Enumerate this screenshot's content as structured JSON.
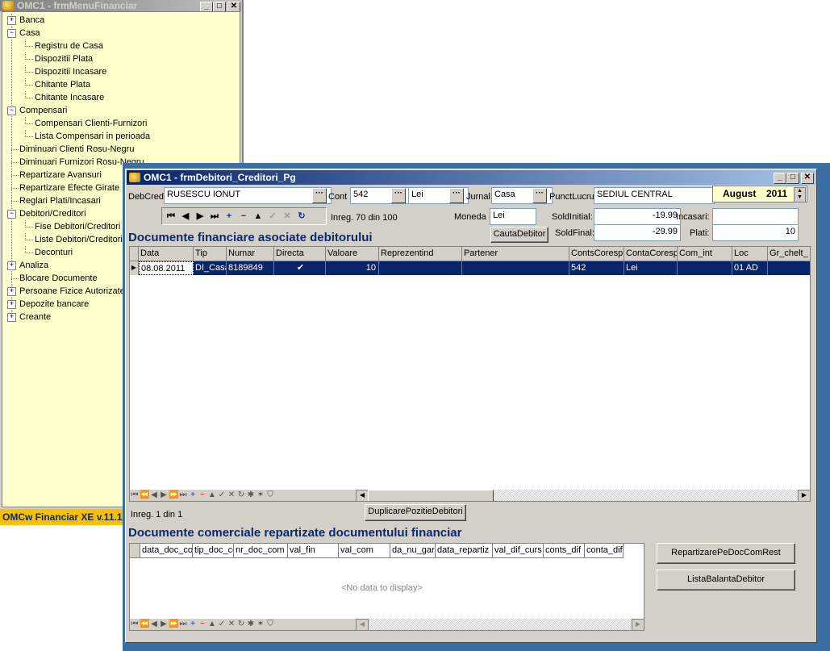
{
  "menu_window": {
    "title": "OMC1 - frmMenuFinanciar",
    "tree": [
      {
        "label": "Banca",
        "level": 0,
        "expander": "+"
      },
      {
        "label": "Casa",
        "level": 0,
        "expander": "-"
      },
      {
        "label": "Registru de Casa",
        "level": 1
      },
      {
        "label": "Dispozitii Plata",
        "level": 1
      },
      {
        "label": "Dispozitii Incasare",
        "level": 1
      },
      {
        "label": "Chitante Plata",
        "level": 1
      },
      {
        "label": "Chitante Incasare",
        "level": 1
      },
      {
        "label": "Compensari",
        "level": 0,
        "expander": "-"
      },
      {
        "label": "Compensari Clienti-Furnizori",
        "level": 1
      },
      {
        "label": "Lista Compensari in perioada",
        "level": 1
      },
      {
        "label": "Diminuari Clienti Rosu-Negru",
        "level": 0
      },
      {
        "label": "Diminuari Furnizori Rosu-Negru",
        "level": 0
      },
      {
        "label": "Repartizare Avansuri",
        "level": 0
      },
      {
        "label": "Repartizare Efecte Girate",
        "level": 0
      },
      {
        "label": "Reglari Plati/Incasari",
        "level": 0
      },
      {
        "label": "Debitori/Creditori",
        "level": 0,
        "expander": "-"
      },
      {
        "label": "Fise Debitori/Creditori",
        "level": 1
      },
      {
        "label": "Liste Debitori/Creditori",
        "level": 1
      },
      {
        "label": "Deconturi",
        "level": 1
      },
      {
        "label": "Analiza",
        "level": 0,
        "expander": "+"
      },
      {
        "label": "Blocare Documente",
        "level": 0
      },
      {
        "label": "Persoane Fizice Autorizate",
        "level": 0,
        "expander": "+"
      },
      {
        "label": "Depozite bancare",
        "level": 0,
        "expander": "+"
      },
      {
        "label": "Creante",
        "level": 0,
        "expander": "+"
      }
    ],
    "version": "OMCw Financiar XE v.11.1"
  },
  "main_window": {
    "title": "OMC1 - frmDebitori_Creditori_Pg",
    "debcred_label": "DebCred",
    "debcred_value": "RUSESCU IONUT",
    "cont_label": "Cont",
    "cont_value": "542",
    "currency_value": "Lei",
    "jurnal_label": "Jurnal",
    "jurnal_value": "Casa",
    "punctlucru_label": "PunctLucru",
    "punctlucru_value": "SEDIUL CENTRAL",
    "period_month": "August",
    "period_year": "2011",
    "record_info": "Inreg. 70 din 100",
    "moneda_label": "Moneda",
    "moneda_value": "Lei",
    "soldinitial_label": "SoldInitial:",
    "soldinitial_value": "-19.99",
    "incasari_label": "Incasari:",
    "incasari_value": "",
    "soldfinal_label": "SoldFinal:",
    "soldfinal_value": "-29.99",
    "plati_label": "Plati:",
    "plati_value": "10",
    "cauta_button": "CautaDebitor",
    "section1_title": "Documente financiare asociate debitorului",
    "grid1_columns": [
      "Data",
      "Tip",
      "Numar",
      "Directa",
      "Valoare",
      "Reprezentind",
      "Partener",
      "ContsCoresp",
      "ContaCoresp",
      "Com_int",
      "Loc",
      "Gr_chelt_"
    ],
    "grid1_row": {
      "Data": "08.08.2011",
      "Tip": "DI_Casa",
      "Numar": "8189849",
      "Directa": "✔",
      "Valoare": "10",
      "Reprezentind": "",
      "Partener": "",
      "ContsCoresp": "542",
      "ContaCoresp": "Lei",
      "Com_int": "",
      "Loc": "01 AD",
      "Gr_chelt_": ""
    },
    "grid1_record_info": "Inreg. 1 din 1",
    "duplicare_button": "DuplicarePozitieDebitori",
    "section2_title": "Documente comerciale repartizate documentului financiar",
    "grid2_columns": [
      "data_doc_co",
      "tip_doc_co",
      "nr_doc_com",
      "val_fin",
      "val_com",
      "da_nu_gar",
      "data_repartiz",
      "val_dif_curs",
      "conts_dif",
      "conta_dif"
    ],
    "grid2_empty": "<No data to display>",
    "repartizare_button": "RepartizarePeDocComRest",
    "lista_button": "ListaBalantaDebitor"
  },
  "colors": {
    "title_active": "#08246b",
    "menu_bg": "#ffffcc",
    "selected_row": "#0a246a",
    "section_title": "#0a2a6b",
    "version_bg": "#f8c000"
  }
}
